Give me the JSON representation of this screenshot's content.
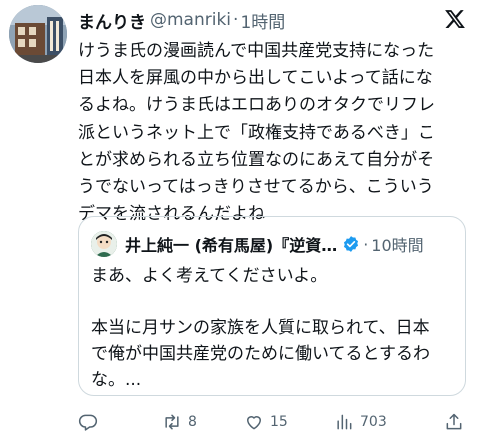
{
  "tweet": {
    "display_name": "まんりき",
    "handle": "@manriki",
    "separator": "·",
    "time": "1時間",
    "text_lines": [
      "けうま氏の漫画読んで中国共産党支持になった",
      "日本人を屏風の中から出してこいよって話にな",
      "るよね。けうま氏はエロありのオタクでリフレ",
      "派というネット上で「政権支持であるべき」こ",
      "とが求められる立ち位置なのにあえて自分がそ",
      "うでないってはっきりさせてるから、こういう",
      "デマを流されるんだよね"
    ]
  },
  "quote": {
    "display_name": "井上純一 (希有馬屋)『逆資…",
    "separator": "·",
    "time": "10時間",
    "text_lines": [
      "まあ、よく考えてくださいよ。",
      "",
      "本当に月サンの家族を人質に取られて、日本",
      "で俺が中国共産党のために働いてるとするわ",
      "な。..."
    ]
  },
  "actions": {
    "reply": {
      "icon": "reply-icon",
      "count": ""
    },
    "retweet": {
      "icon": "retweet-icon",
      "count": "8"
    },
    "like": {
      "icon": "heart-icon",
      "count": "15"
    },
    "views": {
      "icon": "views-icon",
      "count": "703"
    },
    "share": {
      "icon": "share-icon",
      "count": ""
    }
  },
  "colors": {
    "text": "#0f1419",
    "secondary": "#536471",
    "border": "#cfd9de",
    "verified": "#1d9bf0"
  }
}
